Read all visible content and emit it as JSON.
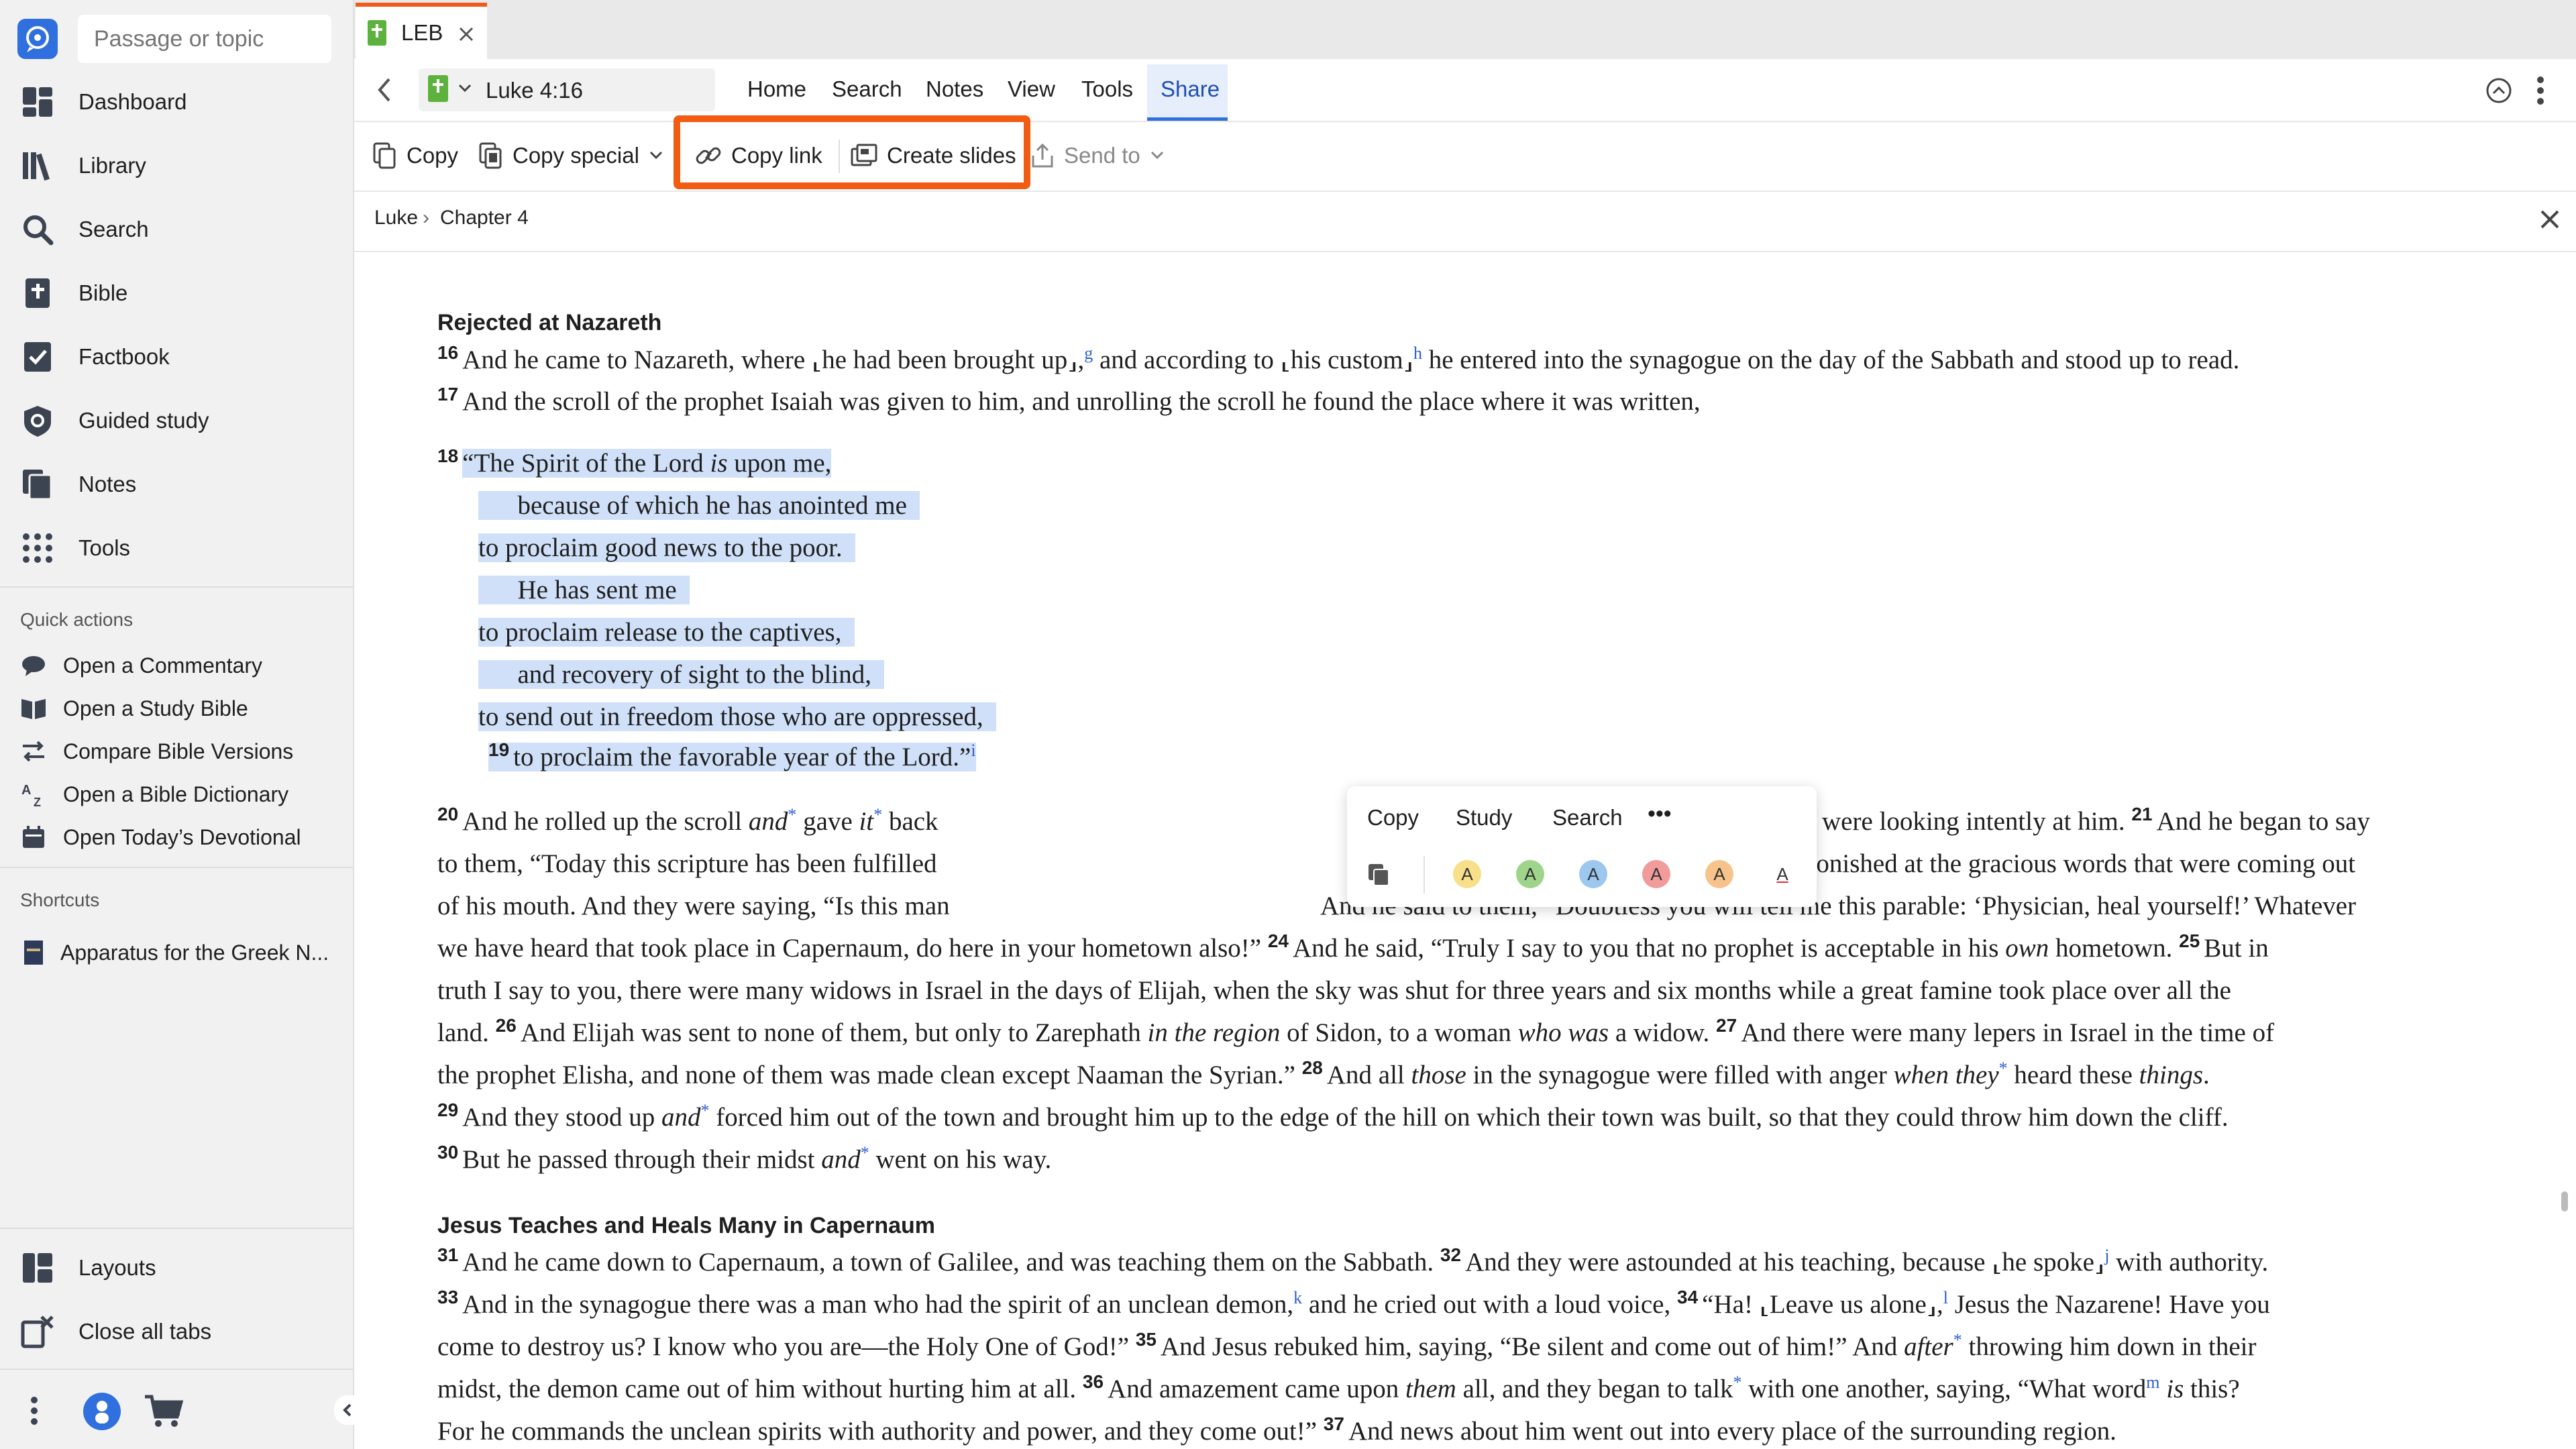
{
  "sidebar": {
    "search_placeholder": "Passage or topic",
    "nav": [
      {
        "label": "Dashboard",
        "icon": "dashboard-icon"
      },
      {
        "label": "Library",
        "icon": "library-icon"
      },
      {
        "label": "Search",
        "icon": "search-icon"
      },
      {
        "label": "Bible",
        "icon": "bible-icon"
      },
      {
        "label": "Factbook",
        "icon": "factbook-icon"
      },
      {
        "label": "Guided study",
        "icon": "guided-study-icon"
      },
      {
        "label": "Notes",
        "icon": "notes-icon"
      },
      {
        "label": "Tools",
        "icon": "tools-icon"
      }
    ],
    "quick_actions_title": "Quick actions",
    "quick_actions": [
      "Open a Commentary",
      "Open a Study Bible",
      "Compare Bible Versions",
      "Open a Bible Dictionary",
      "Open Today’s Devotional"
    ],
    "shortcuts_title": "Shortcuts",
    "shortcut": "Apparatus for the Greek N...",
    "bottom_nav": [
      "Layouts",
      "Close all tabs"
    ]
  },
  "tab": {
    "label": "LEB"
  },
  "reference": "Luke 4:16",
  "menu": [
    "Home",
    "Search",
    "Notes",
    "View",
    "Tools",
    "Share"
  ],
  "active_menu": "Share",
  "toolbar": {
    "copy": "Copy",
    "copy_special": "Copy special",
    "copy_link": "Copy link",
    "create_slides": "Create slides",
    "send_to": "Send to"
  },
  "breadcrumb": {
    "book": "Luke",
    "sep": "›",
    "chapter": "Chapter 4"
  },
  "headings": {
    "h1": "Rejected at Nazareth",
    "h2": "Jesus Teaches and Heals Many in Capernaum"
  },
  "popup": {
    "copy": "Copy",
    "study": "Study",
    "search": "Search",
    "more": "•••"
  },
  "colors": {
    "accent": "#2f6fde",
    "highlight_box": "#f25b12",
    "selection": "#cfe0f8",
    "tab_accent": "#f05a1a"
  }
}
